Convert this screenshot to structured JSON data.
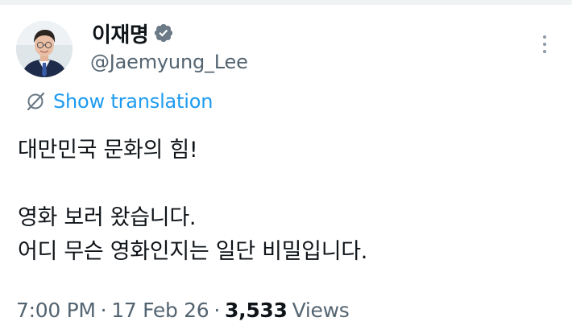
{
  "author": {
    "display_name": "이재명",
    "handle": "@Jaemyung_Lee",
    "verified_icon": "verified-badge-icon",
    "verified_color": "#6b7a86"
  },
  "translation": {
    "label": "Show translation",
    "icon": "globe-slash-icon",
    "color": "#1d9bf0"
  },
  "tweet": {
    "lines": [
      "대만민국 문화의 힘!",
      "",
      "영화 보러 왔습니다.",
      "어디 무슨 영화인지는 일단 비밀입니다."
    ]
  },
  "meta": {
    "time": "7:00 PM",
    "separator": "·",
    "date": "17 Feb 26",
    "views_count": "3,533",
    "views_label": "Views"
  },
  "menu": {
    "icon": "more-vertical-icon"
  }
}
